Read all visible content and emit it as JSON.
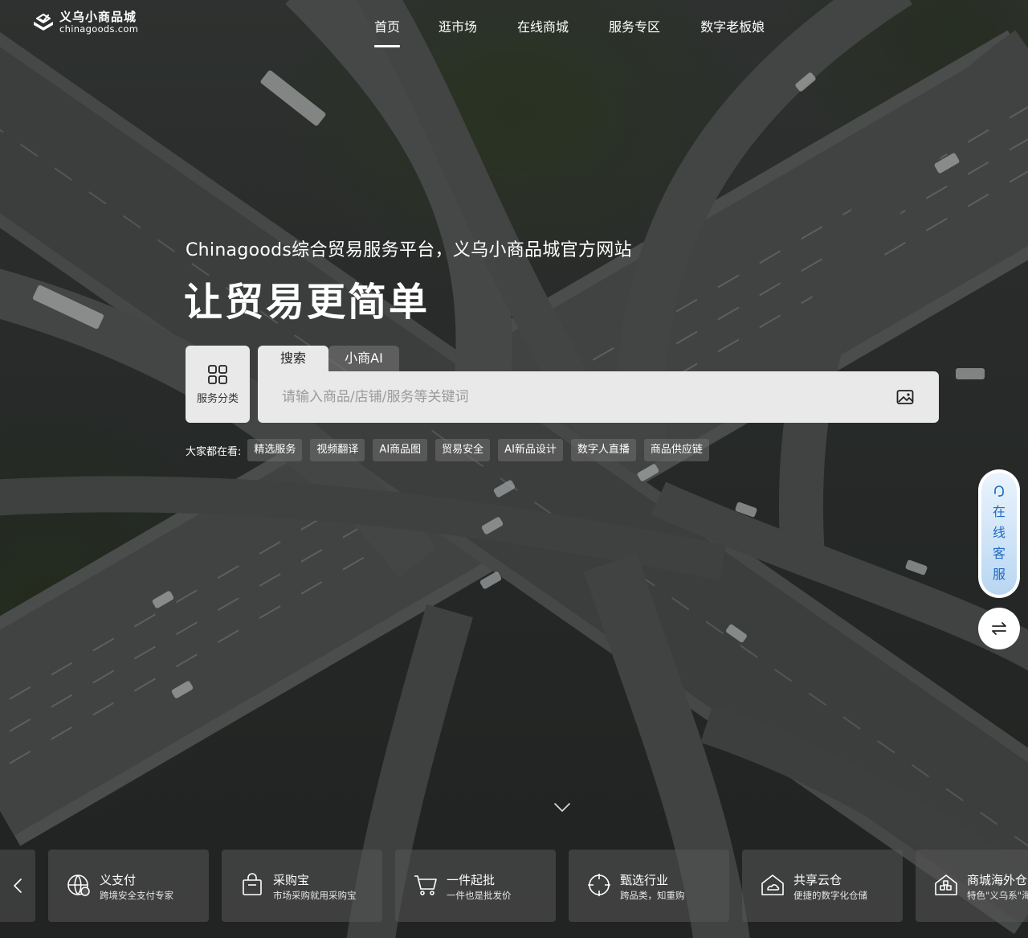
{
  "brand": {
    "name_cn": "义乌小商品城",
    "name_en": "chinagoods.com"
  },
  "nav": {
    "items": [
      {
        "label": "首页",
        "active": true
      },
      {
        "label": "逛市场",
        "active": false
      },
      {
        "label": "在线商城",
        "active": false
      },
      {
        "label": "服务专区",
        "active": false
      },
      {
        "label": "数字老板娘",
        "active": false
      }
    ]
  },
  "hero": {
    "subtitle": "Chinagoods综合贸易服务平台，义乌小商品城官方网站",
    "headline": "让贸易更简单"
  },
  "search": {
    "category_label": "服务分类",
    "category_icon": "grid-icon",
    "tabs": [
      {
        "label": "搜索",
        "active": true
      },
      {
        "label": "小商AI",
        "active": false
      }
    ],
    "value": "",
    "placeholder": "请输入商品/店铺/服务等关键词",
    "image_search_icon": "image-icon"
  },
  "hot": {
    "label": "大家都在看:",
    "tags": [
      "精选服务",
      "视频翻译",
      "AI商品图",
      "贸易安全",
      "AI新品设计",
      "数字人直播",
      "商品供应链"
    ]
  },
  "float": {
    "customer_service_chars": [
      "在",
      "线",
      "客",
      "服"
    ],
    "customer_service_icon": "headset-icon",
    "switch_icon": "switch-arrows-icon",
    "accent_color": "#1f6ac2"
  },
  "scroll_hint_icon": "chevron-down-icon",
  "services": {
    "prev_icon": "chevron-left-icon",
    "cards": [
      {
        "title": "义支付",
        "desc": "跨境安全支付专家",
        "icon": "globe-pay-icon"
      },
      {
        "title": "采购宝",
        "desc": "市场采购就用采购宝",
        "icon": "shopping-bag-icon"
      },
      {
        "title": "一件起批",
        "desc": "一件也是批发价",
        "icon": "cart-icon"
      },
      {
        "title": "甄选行业",
        "desc": "跨品类，知重购",
        "icon": "target-icon"
      },
      {
        "title": "共享云仓",
        "desc": "便捷的数字化仓储",
        "icon": "warehouse-icon"
      },
      {
        "title": "商城海外仓",
        "desc": "特色\"义乌系\"海",
        "icon": "overseas-warehouse-icon"
      }
    ]
  }
}
